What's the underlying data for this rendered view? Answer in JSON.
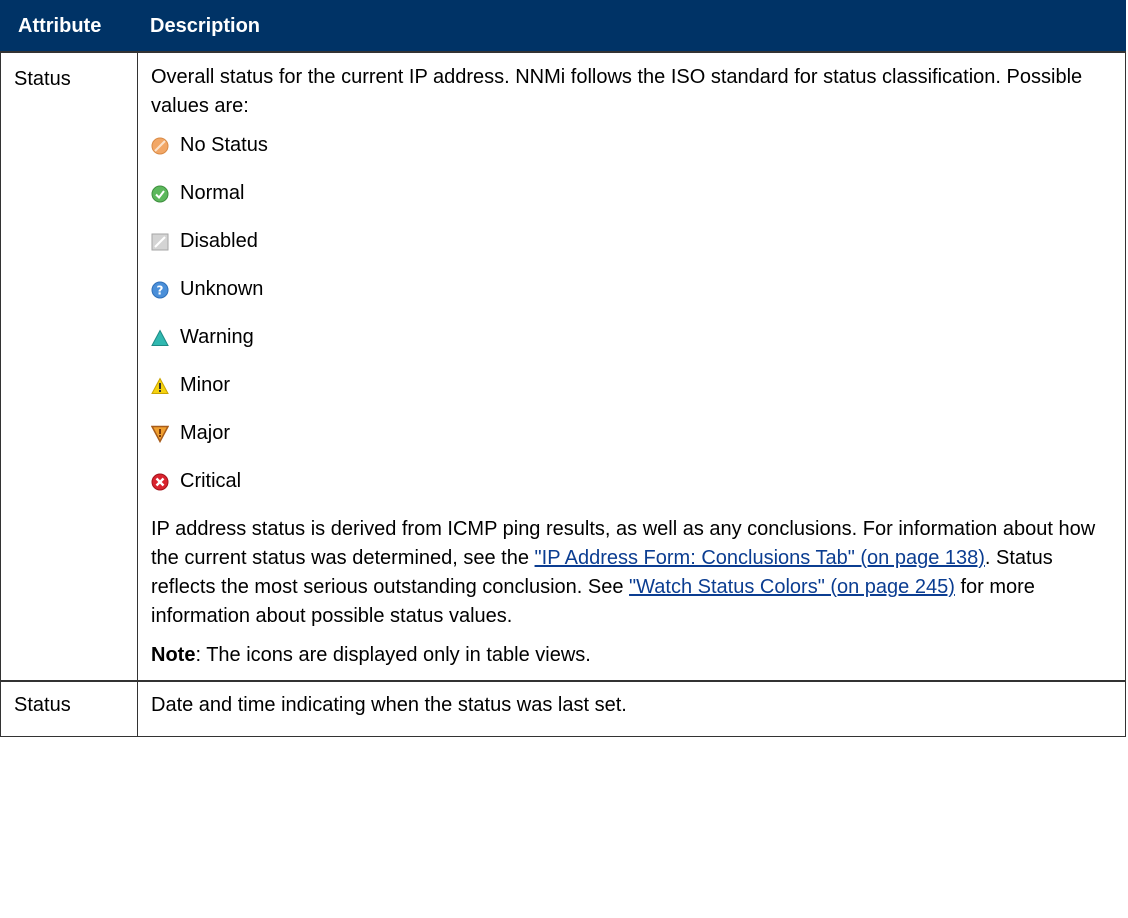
{
  "table": {
    "headers": {
      "attribute": "Attribute",
      "description": "Description"
    },
    "rows": [
      {
        "attribute": "Status",
        "intro": "Overall status for the current IP address. NNMi follows the ISO standard for status classification. Possible values are:",
        "status_values": [
          {
            "icon": "no-status-icon",
            "label": "No Status"
          },
          {
            "icon": "normal-icon",
            "label": "Normal"
          },
          {
            "icon": "disabled-icon",
            "label": "Disabled"
          },
          {
            "icon": "unknown-icon",
            "label": "Unknown"
          },
          {
            "icon": "warning-icon",
            "label": "Warning"
          },
          {
            "icon": "minor-icon",
            "label": "Minor"
          },
          {
            "icon": "major-icon",
            "label": "Major"
          },
          {
            "icon": "critical-icon",
            "label": "Critical"
          }
        ],
        "para": {
          "text1": "IP address status is derived from ICMP ping results, as well as any conclusions. For information about how the current status was determined, see the ",
          "link1": "\"IP Address Form: Conclusions Tab\" (on page 138)",
          "text2": ". Status reflects the most serious outstanding conclusion. See ",
          "link2": "\"Watch Status Colors\" (on page 245)",
          "text3": " for more information about possible status values."
        },
        "note_label": "Note",
        "note_text": ": The icons are displayed only in table views."
      },
      {
        "attribute": "Status",
        "description": "Date and time indicating when the status was last set."
      }
    ]
  },
  "colors": {
    "header_bg": "#003366",
    "link": "#0b3d91",
    "no_status": "#f2a766",
    "normal": "#5cb85c",
    "disabled": "#bfbfbf",
    "unknown": "#4a8fd9",
    "warning": "#30b8b0",
    "minor": "#f5d20f",
    "major": "#f0a030",
    "critical": "#d9232e"
  }
}
